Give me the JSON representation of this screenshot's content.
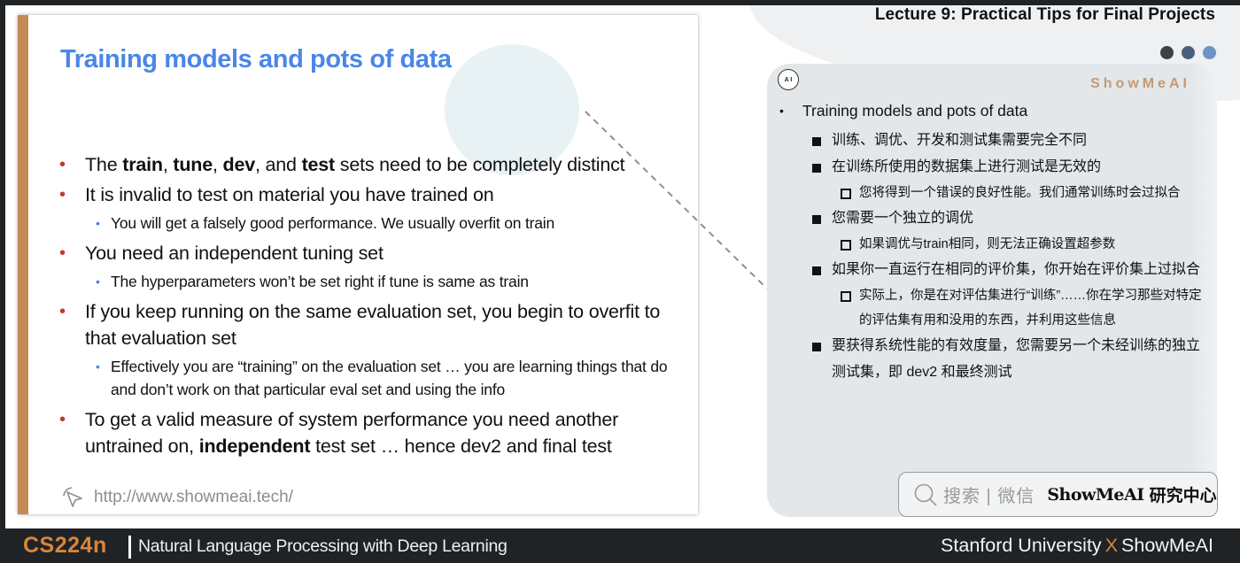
{
  "header": {
    "lecture_title": "Lecture 9: Practical Tips for Final Projects",
    "dot_colors": [
      "#3d4247",
      "#4a5f7d",
      "#6c93c4"
    ]
  },
  "slide": {
    "title": "Training models and pots of data",
    "accent_color": "#c28a56",
    "title_color": "#4a86e8",
    "bullets": [
      {
        "level": 1,
        "segments": [
          {
            "text": "The ",
            "bold": false
          },
          {
            "text": "train",
            "bold": true
          },
          {
            "text": ", ",
            "bold": false
          },
          {
            "text": "tune",
            "bold": true
          },
          {
            "text": ", ",
            "bold": false
          },
          {
            "text": "dev",
            "bold": true
          },
          {
            "text": ", and ",
            "bold": false
          },
          {
            "text": "test",
            "bold": true
          },
          {
            "text": " sets need to be completely distinct",
            "bold": false
          }
        ]
      },
      {
        "level": 1,
        "segments": [
          {
            "text": "It is invalid to test on material you have trained on",
            "bold": false
          }
        ]
      },
      {
        "level": 2,
        "segments": [
          {
            "text": "You will get a falsely good performance. We usually overfit on train",
            "bold": false
          }
        ]
      },
      {
        "level": 1,
        "segments": [
          {
            "text": "You need an independent tuning set",
            "bold": false
          }
        ]
      },
      {
        "level": 2,
        "segments": [
          {
            "text": "The hyperparameters won’t be set right if tune is same as train",
            "bold": false
          }
        ]
      },
      {
        "level": 1,
        "segments": [
          {
            "text": "If you keep running on the same evaluation set, you begin to overfit to that evaluation set",
            "bold": false
          }
        ]
      },
      {
        "level": 2,
        "segments": [
          {
            "text": "Effectively you are “training” on the evaluation set … you are learning things that do and don’t work on that particular eval set and using the info",
            "bold": false
          }
        ]
      },
      {
        "level": 1,
        "segments": [
          {
            "text": "To get a valid measure of system performance you need another untrained on, ",
            "bold": false
          },
          {
            "text": "independent",
            "bold": true
          },
          {
            "text": " test set … hence dev2 and final test",
            "bold": false
          }
        ]
      }
    ],
    "url": "http://www.showmeai.tech/"
  },
  "panel": {
    "badge": "A I",
    "brand": "ShowMeAI",
    "items": [
      {
        "level": 0,
        "text": "Training models and pots of data"
      },
      {
        "level": 1,
        "text": "训练、调优、开发和测试集需要完全不同"
      },
      {
        "level": 1,
        "text": "在训练所使用的数据集上进行测试是无效的"
      },
      {
        "level": 2,
        "text": "您将得到一个错误的良好性能。我们通常训练时会过拟合"
      },
      {
        "level": 1,
        "text": "您需要一个独立的调优"
      },
      {
        "level": 2,
        "text": "如果调优与train相同，则无法正确设置超参数"
      },
      {
        "level": 1,
        "text": "如果你一直运行在相同的评价集，你开始在评价集上过拟合"
      },
      {
        "level": 2,
        "text": "实际上，你是在对评估集进行“训练”……你在学习那些对特定的评估集有用和没用的东西，并利用这些信息"
      },
      {
        "level": 1,
        "text": "要获得系统性能的有效度量，您需要另一个未经训练的独立测试集，即 dev2 和最终测试"
      }
    ],
    "search": {
      "hint": "搜索 | 微信",
      "brand": "ShowMeAI",
      "brand_cn": "研究中心"
    }
  },
  "footer": {
    "course_code": "CS224n",
    "course_name": "Natural Language Processing with Deep Learning",
    "partner_left": "Stanford University",
    "partner_x": "X",
    "partner_right": "ShowMeAI",
    "accent_color": "#d8853b"
  }
}
